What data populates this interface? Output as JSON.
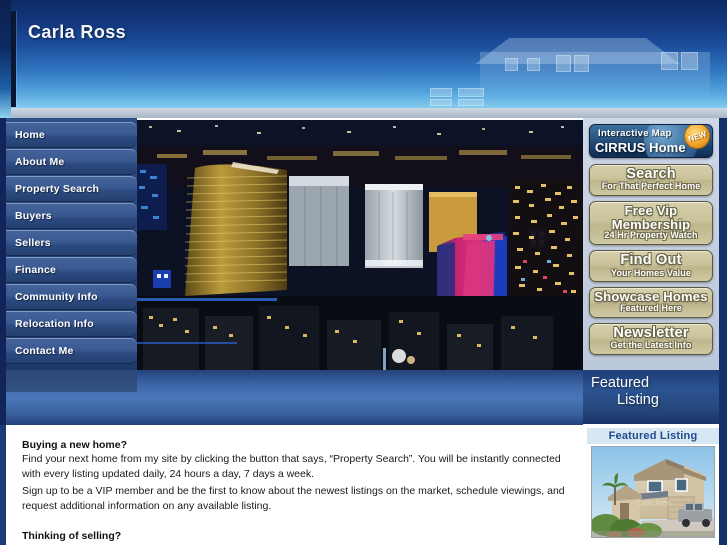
{
  "header": {
    "site_title": "Carla Ross",
    "watermark": "house-silhouette"
  },
  "left_nav": {
    "items": [
      {
        "label": "Home"
      },
      {
        "label": "About Me"
      },
      {
        "label": "Property Search"
      },
      {
        "label": "Buyers"
      },
      {
        "label": "Sellers"
      },
      {
        "label": "Finance"
      },
      {
        "label": "Community Info"
      },
      {
        "label": "Relocation Info"
      },
      {
        "label": "Contact Me"
      }
    ]
  },
  "hero": {
    "alt": "Las Vegas strip skyline at night"
  },
  "right_sidebar": {
    "cirrus": {
      "line1": "Interactive Map",
      "line2": "CIRRUS Home Search",
      "badge": "NEW"
    },
    "buttons": [
      {
        "main": "Search",
        "sub": "For That Perfect Home"
      },
      {
        "main": "Free Vip Membership",
        "sub": "24 Hr Property Watch"
      },
      {
        "main": "Find Out",
        "sub": "Your Homes Value"
      },
      {
        "main": "Showcase Homes",
        "sub": "Featured Here"
      },
      {
        "main": "Newsletter",
        "sub": "Get the Latest Info"
      }
    ]
  },
  "featured": {
    "heading_line1": "Featured",
    "heading_line2": "Listing",
    "card_title": "Featured Listing",
    "photo_alt": "Two-story stucco home with attached garage and truck in driveway"
  },
  "content": {
    "buying_heading": "Buying a new home?",
    "buying_paragraph_1": "Find your next home from my site by clicking the button that says, “Property Search”.  You will be instantly connected with every listing updated daily, 24 hours a day, 7 days a week.",
    "buying_paragraph_2": "Sign up to be a VIP member and be the first to know about the newest listings on the market, schedule viewings, and request additional information on any available listing.",
    "selling_heading": "Thinking of selling?"
  },
  "colors": {
    "header_top": "#0e2a63",
    "header_bottom": "#b7e4f8",
    "nav_blue": "#3a5990",
    "band_blue": "#4a77b8",
    "sidebar_bg": "#c4cfe0",
    "button_tan": "#c9c29a",
    "edge_navy": "#16306b",
    "card_title_blue": "#1f4c8f"
  }
}
